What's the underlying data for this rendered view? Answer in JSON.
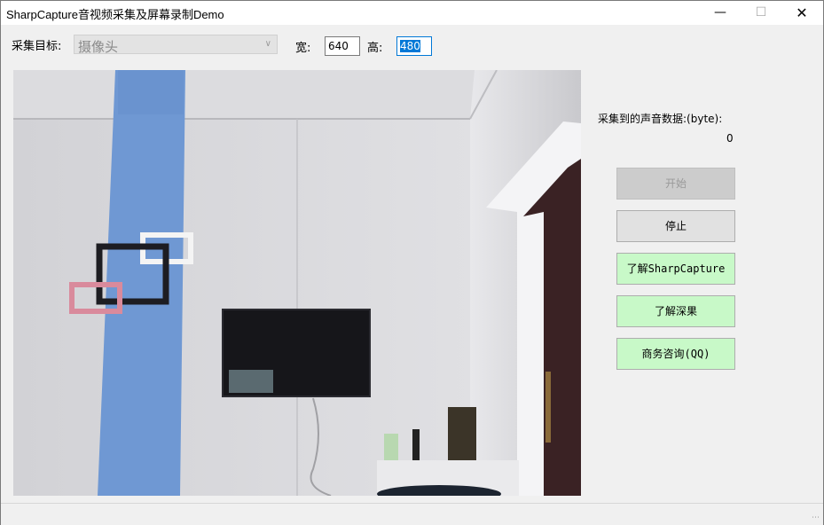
{
  "window": {
    "title": "SharpCapture音视频采集及屏幕录制Demo",
    "minimize_glyph": "—",
    "maximize_glyph": "☐",
    "close_glyph": "✕"
  },
  "capture": {
    "target_label": "采集目标:",
    "target_value": "摄像头",
    "width_label": "宽:",
    "width_value": "640",
    "height_label": "高:",
    "height_value": "480"
  },
  "audio": {
    "label": "采集到的声音数据:(byte):",
    "value": "0"
  },
  "buttons": {
    "start": "开始",
    "stop": "停止",
    "about_sharpcapture": "了解SharpCapture",
    "about_shencai": "了解深果",
    "business_qq": "商务咨询(QQ)"
  },
  "icons": {
    "combo_arrow": "chevron-down-icon",
    "resize_grip": "resize-grip-icon"
  },
  "colors": {
    "green_button": "#c8f9c8",
    "focus_blue": "#0078d7",
    "wall_stripe": "#6f98d3"
  }
}
